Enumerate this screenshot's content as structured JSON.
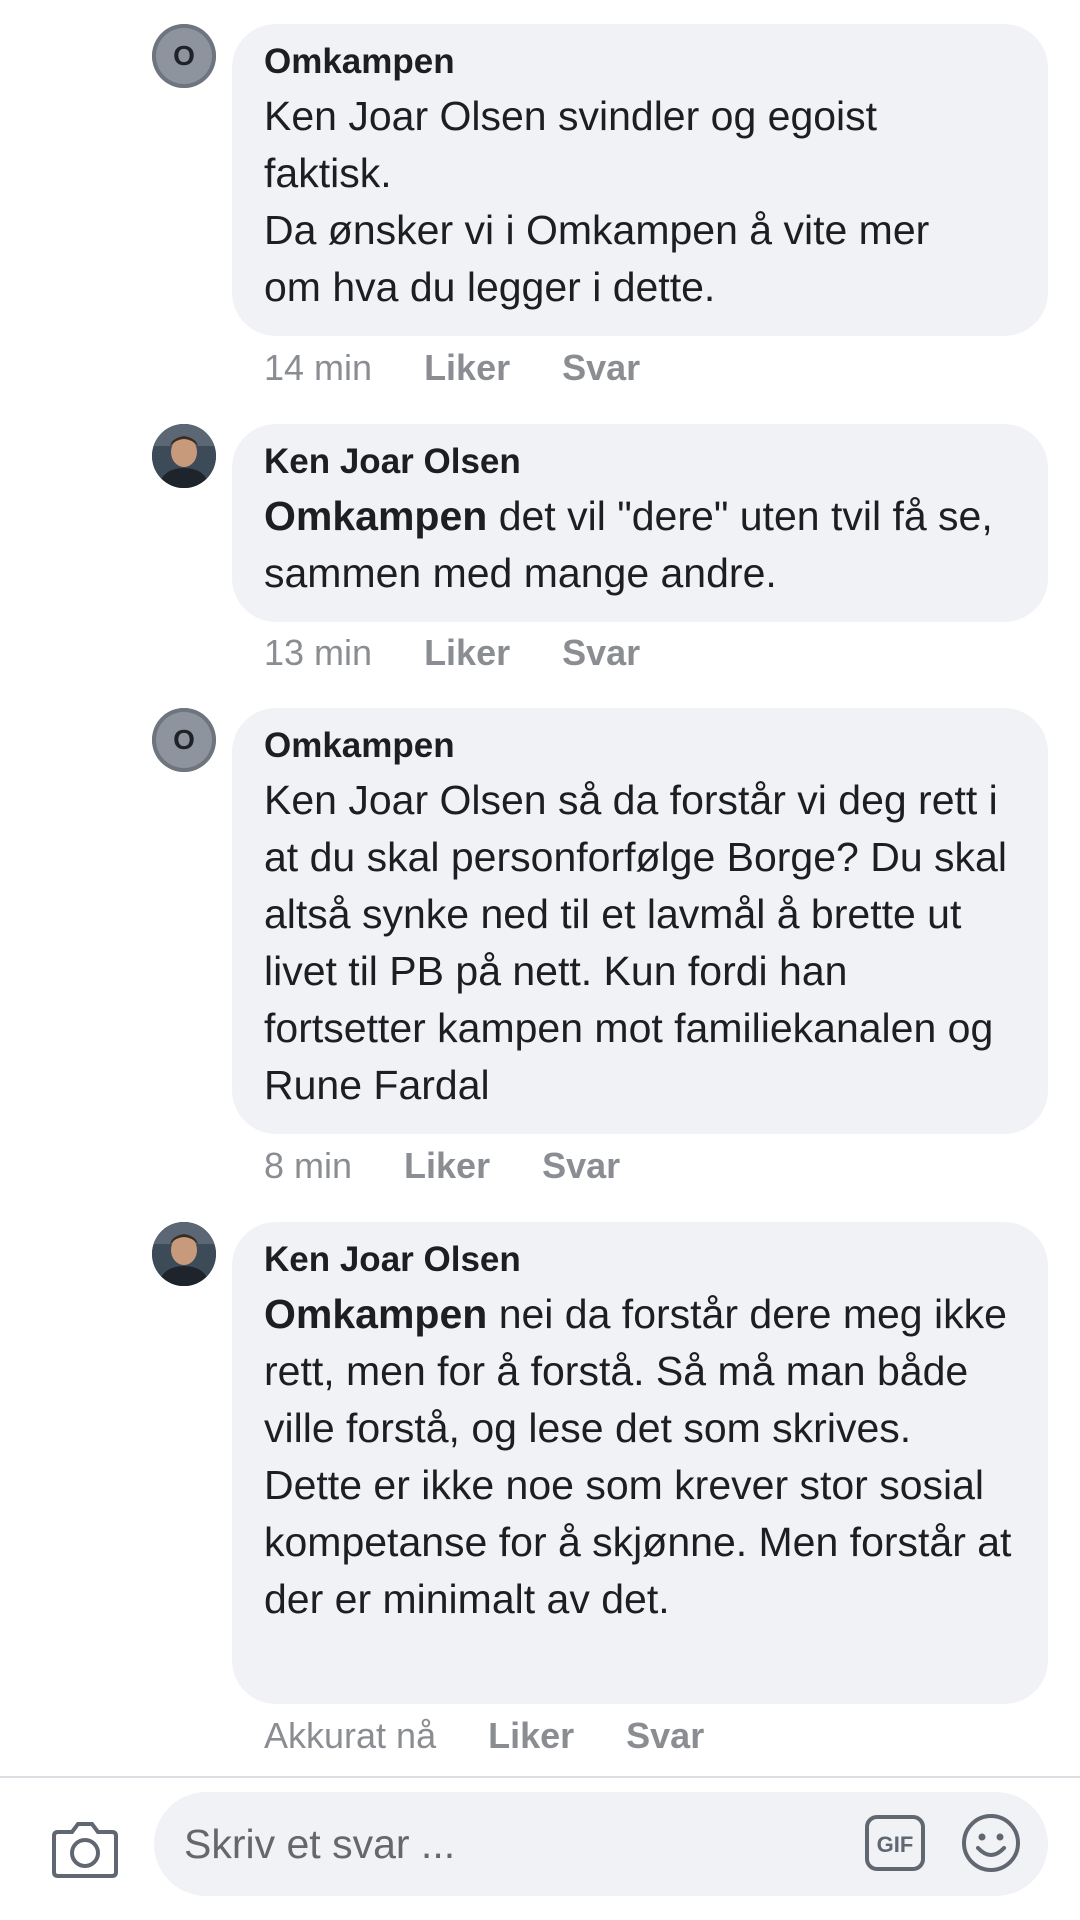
{
  "comments": [
    {
      "author": "Omkampen",
      "avatar_letter": "O",
      "mention": "",
      "text": "Ken Joar Olsen svindler og egoist faktisk.\nDa ønsker vi i Omkampen å vite mer om hva du legger i dette.",
      "time": "14 min",
      "like_label": "Liker",
      "reply_label": "Svar"
    },
    {
      "author": "Ken Joar Olsen",
      "avatar_icon": "profile-photo",
      "mention": "Omkampen",
      "text": " det vil \"dere\" uten tvil få se, sammen med mange andre.",
      "time": "13 min",
      "like_label": "Liker",
      "reply_label": "Svar"
    },
    {
      "author": "Omkampen",
      "avatar_letter": "O",
      "mention": "",
      "text": "Ken Joar Olsen så da forstår vi deg rett i at du skal personforfølge Borge? Du skal altså synke ned til et lavmål å brette ut livet til PB på nett. Kun fordi han fortsetter kampen mot familiekanalen og Rune Fardal",
      "time": "8 min",
      "like_label": "Liker",
      "reply_label": "Svar"
    },
    {
      "author": "Ken Joar Olsen",
      "avatar_icon": "profile-photo",
      "mention": "Omkampen",
      "text": " nei da forstår dere meg ikke rett, men for å forstå. Så må man både ville forstå, og lese det som skrives. Dette er ikke noe som krever stor sosial kompetanse for å skjønne. Men forstår at der er minimalt av det.",
      "time": "Akkurat nå",
      "like_label": "Liker",
      "reply_label": "Svar"
    }
  ],
  "composer": {
    "placeholder": "Skriv et svar ...",
    "camera_icon": "camera-icon",
    "gif_icon": "gif-icon",
    "gif_label": "GIF",
    "emoji_icon": "emoji-icon"
  },
  "colors": {
    "bubble": "#f0f2f5",
    "meta_text": "#8a8d91",
    "body_text": "#1c1e21"
  }
}
